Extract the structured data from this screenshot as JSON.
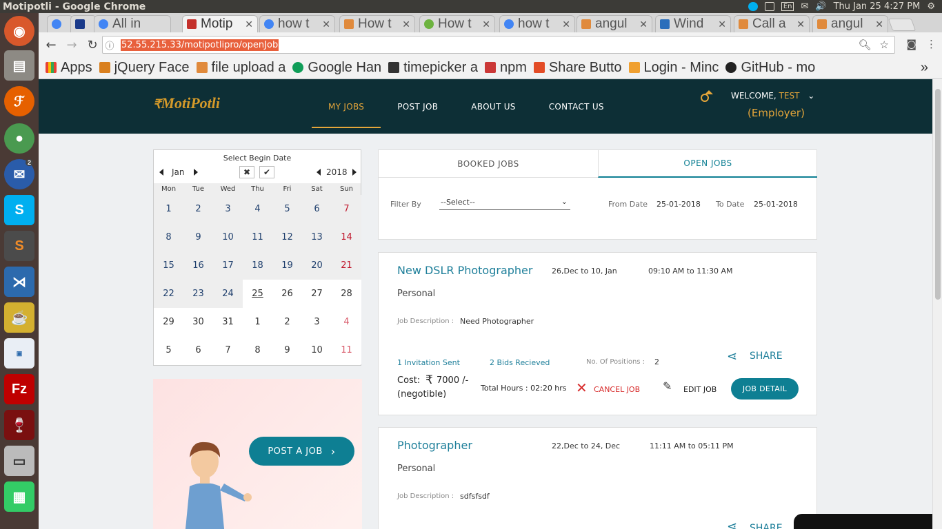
{
  "os": {
    "window_title": "Motipotli - Google Chrome",
    "clock": "Thu Jan 25  4:27 PM",
    "lang": "En"
  },
  "launcher": {
    "badge": "2",
    "items": [
      "ubuntu-icon",
      "files-icon",
      "firefox-icon",
      "chrome-icon",
      "thunderbird-icon",
      "skype-icon",
      "sublime-icon",
      "vscode-icon",
      "teapot-icon",
      "workbench-icon",
      "filezilla-icon",
      "wine-icon",
      "scanner-icon",
      "drive-icon"
    ]
  },
  "tabs": [
    {
      "label": "",
      "fav": "#4285f4"
    },
    {
      "label": "",
      "fav": "#1a3a8a"
    },
    {
      "label": "All in",
      "fav": "#4285f4"
    },
    {
      "label": "Motip",
      "fav": "#c4302b"
    },
    {
      "label": "how t",
      "fav": "#4285f4"
    },
    {
      "label": "How t",
      "fav": "#e08a3c"
    },
    {
      "label": "How t",
      "fav": "#6db33f"
    },
    {
      "label": "how t",
      "fav": "#4285f4"
    },
    {
      "label": "angul",
      "fav": "#e08a3c"
    },
    {
      "label": "Wind",
      "fav": "#2a6ebb"
    },
    {
      "label": "Call a",
      "fav": "#e08a3c"
    },
    {
      "label": "angul",
      "fav": "#e08a3c"
    }
  ],
  "toolbar": {
    "url": "52.55.215.33/motipotlipro/openJob"
  },
  "bookmarks": [
    {
      "label": "Apps",
      "color": "#e94235"
    },
    {
      "label": "jQuery Face",
      "color": "#d9801f"
    },
    {
      "label": "file upload a",
      "color": "#e08a3c"
    },
    {
      "label": "Google Han",
      "color": "#0f9d58"
    },
    {
      "label": "timepicker a",
      "color": "#333333"
    },
    {
      "label": "npm",
      "color": "#cb3837"
    },
    {
      "label": "Share Butto",
      "color": "#e34c26"
    },
    {
      "label": "Login - Minc",
      "color": "#f0a030"
    },
    {
      "label": "GitHub - mo",
      "color": "#222222"
    }
  ],
  "header": {
    "logo": "MotiPotli",
    "nav": [
      "MY JOBS",
      "POST JOB",
      "ABOUT US",
      "CONTACT US"
    ],
    "welcome": "WELCOME,",
    "user": "TEST",
    "role": "(Employer)"
  },
  "calendar": {
    "title": "Select Begin Date",
    "month": "Jan",
    "year": "2018",
    "weekdays": [
      "Mon",
      "Tue",
      "Wed",
      "Thu",
      "Fri",
      "Sat",
      "Sun"
    ],
    "days": [
      "1",
      "2",
      "3",
      "4",
      "5",
      "6",
      "7",
      "8",
      "9",
      "10",
      "11",
      "12",
      "13",
      "14",
      "15",
      "16",
      "17",
      "18",
      "19",
      "20",
      "21",
      "22",
      "23",
      "24",
      "25",
      "26",
      "27",
      "28",
      "29",
      "30",
      "31",
      "1",
      "2",
      "3",
      "4",
      "5",
      "6",
      "7",
      "8",
      "9",
      "10",
      "11"
    ]
  },
  "promo": {
    "button": "POST A JOB"
  },
  "job_tabs": [
    "BOOKED JOBS",
    "OPEN JOBS"
  ],
  "filter": {
    "label": "Filter By",
    "select": "--Select--",
    "from_label": "From Date",
    "from_value": "25-01-2018",
    "to_label": "To Date",
    "to_value": "25-01-2018"
  },
  "jobs": [
    {
      "title": "New DSLR Photographer",
      "dates": "26,Dec to 10, Jan",
      "time": "09:10 AM to 11:30 AM",
      "type": "Personal",
      "desc_label": "Job Description :",
      "desc": "Need Photographer",
      "invites": "1 Invitation Sent",
      "bids": "2 Bids Recieved",
      "positions_label": "No. Of Positions :",
      "positions": "2",
      "share": "SHARE",
      "cost_label": "Cost:",
      "cost": "7000 /-",
      "negotiable": "(negotible)",
      "hours": "Total Hours : 02:20 hrs",
      "cancel": "CANCEL JOB",
      "edit": "EDIT JOB",
      "detail": "JOB DETAIL"
    },
    {
      "title": "Photographer",
      "dates": "22,Dec to 24, Dec",
      "time": "11:11 AM to 05:11 PM",
      "type": "Personal",
      "desc_label": "Job Description :",
      "desc": "sdfsfsdf",
      "share": "SHARE"
    }
  ]
}
